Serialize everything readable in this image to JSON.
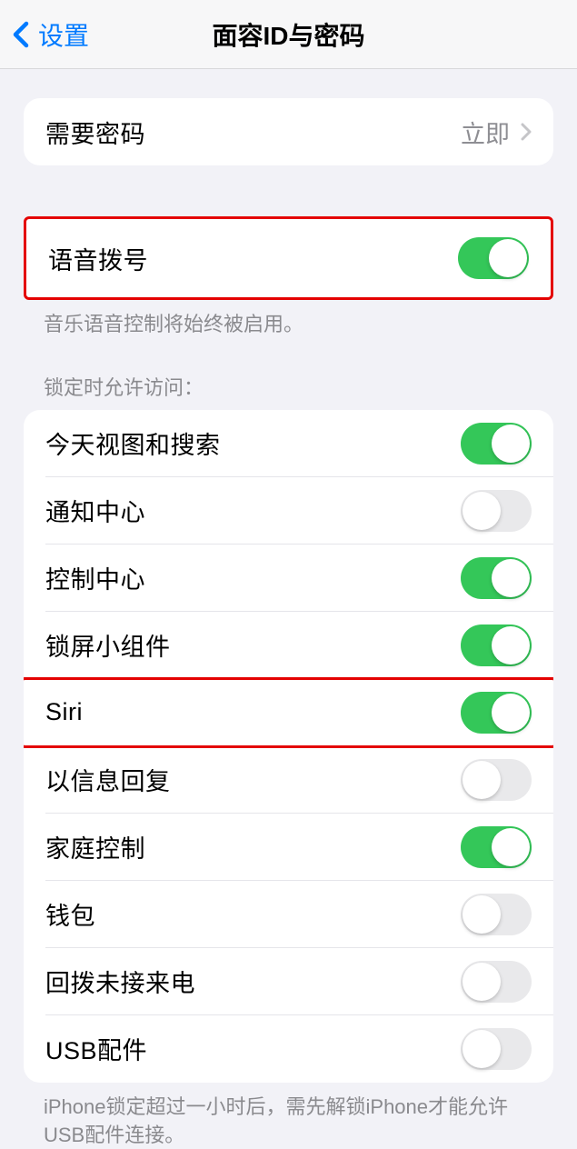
{
  "nav": {
    "back_label": "设置",
    "title": "面容ID与密码"
  },
  "group_passcode": {
    "require_passcode": {
      "label": "需要密码",
      "value": "立即"
    }
  },
  "group_voice": {
    "voice_dial": {
      "label": "语音拨号",
      "on": true
    },
    "footer": "音乐语音控制将始终被启用。"
  },
  "group_lock": {
    "header": "锁定时允许访问：",
    "items": [
      {
        "label": "今天视图和搜索",
        "on": true,
        "highlighted": false
      },
      {
        "label": "通知中心",
        "on": false,
        "highlighted": false
      },
      {
        "label": "控制中心",
        "on": true,
        "highlighted": false
      },
      {
        "label": "锁屏小组件",
        "on": true,
        "highlighted": false
      },
      {
        "label": "Siri",
        "on": true,
        "highlighted": true
      },
      {
        "label": "以信息回复",
        "on": false,
        "highlighted": false
      },
      {
        "label": "家庭控制",
        "on": true,
        "highlighted": false
      },
      {
        "label": "钱包",
        "on": false,
        "highlighted": false
      },
      {
        "label": "回拨未接来电",
        "on": false,
        "highlighted": false
      },
      {
        "label": "USB配件",
        "on": false,
        "highlighted": false
      }
    ],
    "footer": "iPhone锁定超过一小时后，需先解锁iPhone才能允许USB配件连接。"
  }
}
